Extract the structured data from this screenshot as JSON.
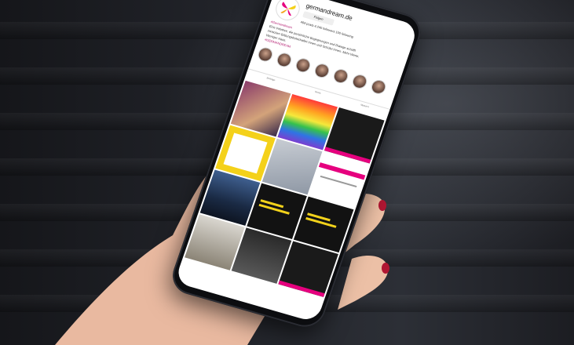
{
  "profile": {
    "username": "germandream.de",
    "follow_label": "Folgen",
    "stats": "469 posts   4.240 followers   100 following",
    "name": "#Germandream",
    "bio_lines": [
      "Eine Initiative, die persönliche Begegnungen und Dialoge schafft",
      "zwischen Bildungsbotschafter:innen und Schüler:innen. Mehr Werte.",
      "Weniger Hass."
    ],
    "hashtag": "#GERMANDREAM"
  },
  "highlights": [
    "Leute",
    "Werte",
    "Wir",
    "Mission",
    "Dialoge",
    "Events",
    "Erfolge"
  ],
  "tabs": [
    "Beiträge",
    "Reels",
    "Markiert"
  ],
  "colors": {
    "accent_pink": "#e6007e",
    "accent_yellow": "#f4d11a"
  }
}
